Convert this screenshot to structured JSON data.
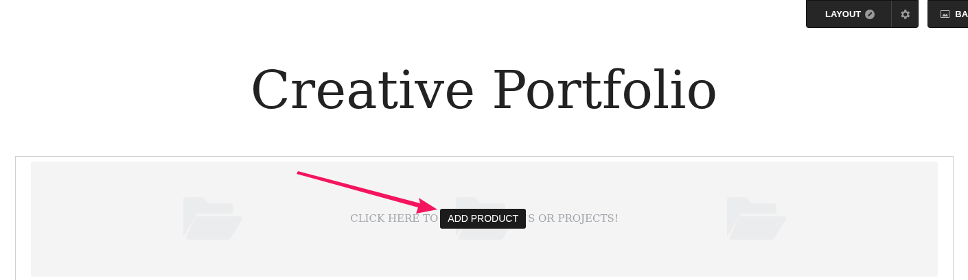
{
  "toolbar": {
    "layout_button": {
      "label": "LAYOUT"
    },
    "background_button": {
      "label": "BA"
    }
  },
  "title": "Creative Portfolio",
  "empty_state": {
    "text_before": "CLICK HERE TO",
    "text_after": "S OR PROJECTS!",
    "tooltip": "ADD PRODUCT"
  }
}
